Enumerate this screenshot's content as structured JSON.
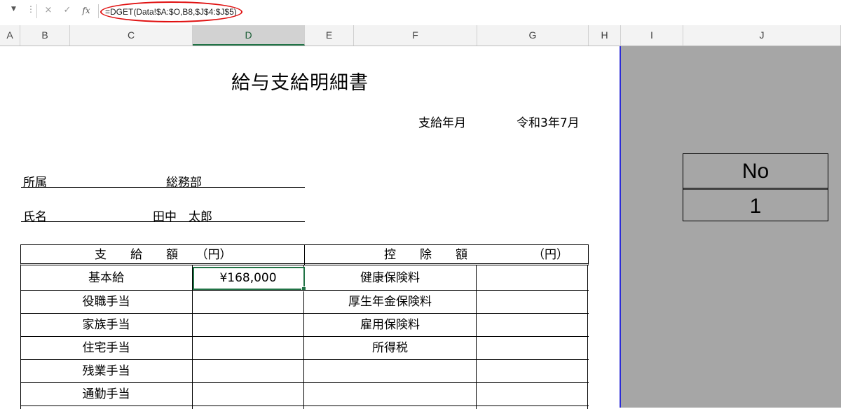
{
  "formula_bar": {
    "formula": "=DGET(Data!$A:$O,B8,$J$4:$J$5)",
    "cancel_icon": "×",
    "enter_icon": "✓",
    "fx_label": "fx"
  },
  "columns": [
    "A",
    "B",
    "C",
    "D",
    "E",
    "F",
    "G",
    "H",
    "I",
    "J"
  ],
  "selected_column": "D",
  "sheet": {
    "title": "給与支給明細書",
    "date_label": "支給年月",
    "date_value": "令和3年7月",
    "dept_label": "所属",
    "dept_value": "総務部",
    "name_label": "氏名",
    "name_value": "田中　太郎",
    "no_box": {
      "header": "No",
      "value": "1"
    },
    "payment_header": "支　　給　　額　　（円）",
    "deduction_header": "控　　除　　額",
    "deduction_unit": "（円）",
    "rows": [
      {
        "pay_item": "基本給",
        "pay_amount": "¥168,000",
        "ded_item": "健康保険料",
        "ded_amount": ""
      },
      {
        "pay_item": "役職手当",
        "pay_amount": "",
        "ded_item": "厚生年金保険料",
        "ded_amount": ""
      },
      {
        "pay_item": "家族手当",
        "pay_amount": "",
        "ded_item": "雇用保険料",
        "ded_amount": ""
      },
      {
        "pay_item": "住宅手当",
        "pay_amount": "",
        "ded_item": "所得税",
        "ded_amount": ""
      },
      {
        "pay_item": "残業手当",
        "pay_amount": "",
        "ded_item": "",
        "ded_amount": ""
      },
      {
        "pay_item": "通勤手当",
        "pay_amount": "",
        "ded_item": "",
        "ded_amount": ""
      }
    ]
  },
  "colors": {
    "selection": "#217346",
    "gray_area": "#a6a6a6",
    "annotation_circle": "#e01010"
  }
}
